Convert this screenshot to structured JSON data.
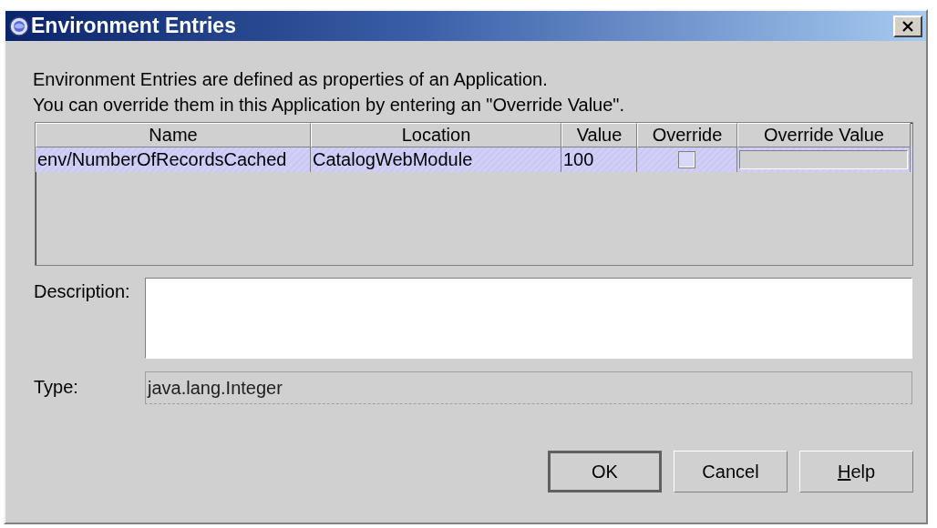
{
  "window": {
    "title": "Environment Entries"
  },
  "intro": [
    "Environment Entries are defined as properties of an Application.",
    "You can override them in this Application by entering an \"Override Value\"."
  ],
  "table": {
    "columns": [
      "Name",
      "Location",
      "Value",
      "Override",
      "Override Value"
    ],
    "rows": [
      {
        "name": "env/NumberOfRecordsCached",
        "location": "CatalogWebModule",
        "value": "100",
        "override": false,
        "selected": true
      }
    ]
  },
  "description": {
    "label": "Description:"
  },
  "type": {
    "label": "Type:",
    "value": "java.lang.Integer"
  },
  "buttons": [
    {
      "label": "OK",
      "default": true,
      "mnemonic_underlined": false
    },
    {
      "label": "Cancel",
      "default": false,
      "mnemonic_underlined": false
    },
    {
      "label": "Help",
      "default": false,
      "mnemonic_underlined": true
    }
  ]
}
